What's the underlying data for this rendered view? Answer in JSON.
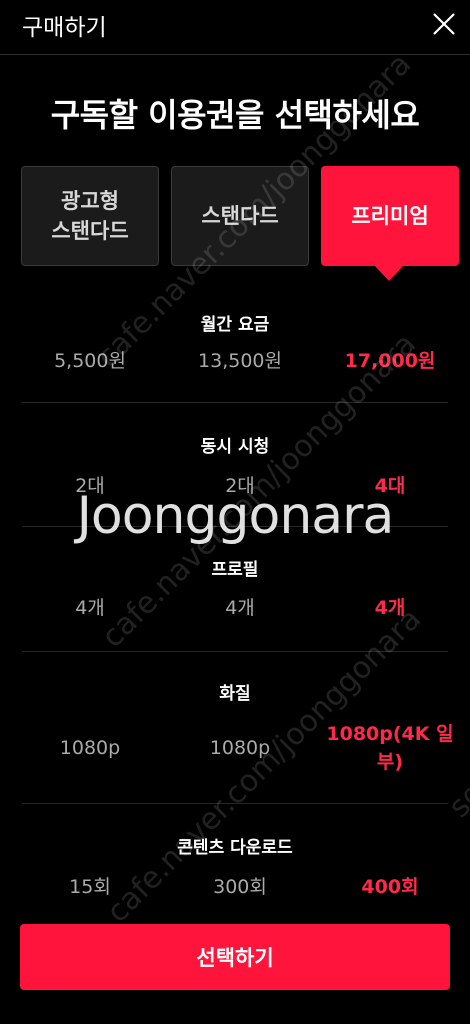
{
  "header": {
    "title": "구매하기",
    "close_icon": "close-icon"
  },
  "headline": "구독할 이용권을 선택하세요",
  "plans": [
    {
      "label": "광고형\n스탠다드",
      "selected": false
    },
    {
      "label": "스탠다드",
      "selected": false
    },
    {
      "label": "프리미엄",
      "selected": true
    }
  ],
  "features": [
    {
      "title": "월간 요금",
      "values": [
        "5,500원",
        "13,500원",
        "17,000원"
      ]
    },
    {
      "title": "동시 시청",
      "values": [
        "2대",
        "2대",
        "4대"
      ]
    },
    {
      "title": "프로필",
      "values": [
        "4개",
        "4개",
        "4개"
      ]
    },
    {
      "title": "화질",
      "values": [
        "1080p",
        "1080p",
        "1080p(4K 일부)"
      ]
    },
    {
      "title": "콘텐츠 다운로드",
      "values": [
        "15회",
        "300회",
        "400회"
      ]
    }
  ],
  "watermark": {
    "logo": "Joonggonara",
    "diagonal": "cafe.naver.com/joonggonara",
    "edge": "sor"
  },
  "select_button": "선택하기",
  "colors": {
    "accent": "#ff153c",
    "accent_text": "#ff2a4b",
    "background": "#000000"
  }
}
